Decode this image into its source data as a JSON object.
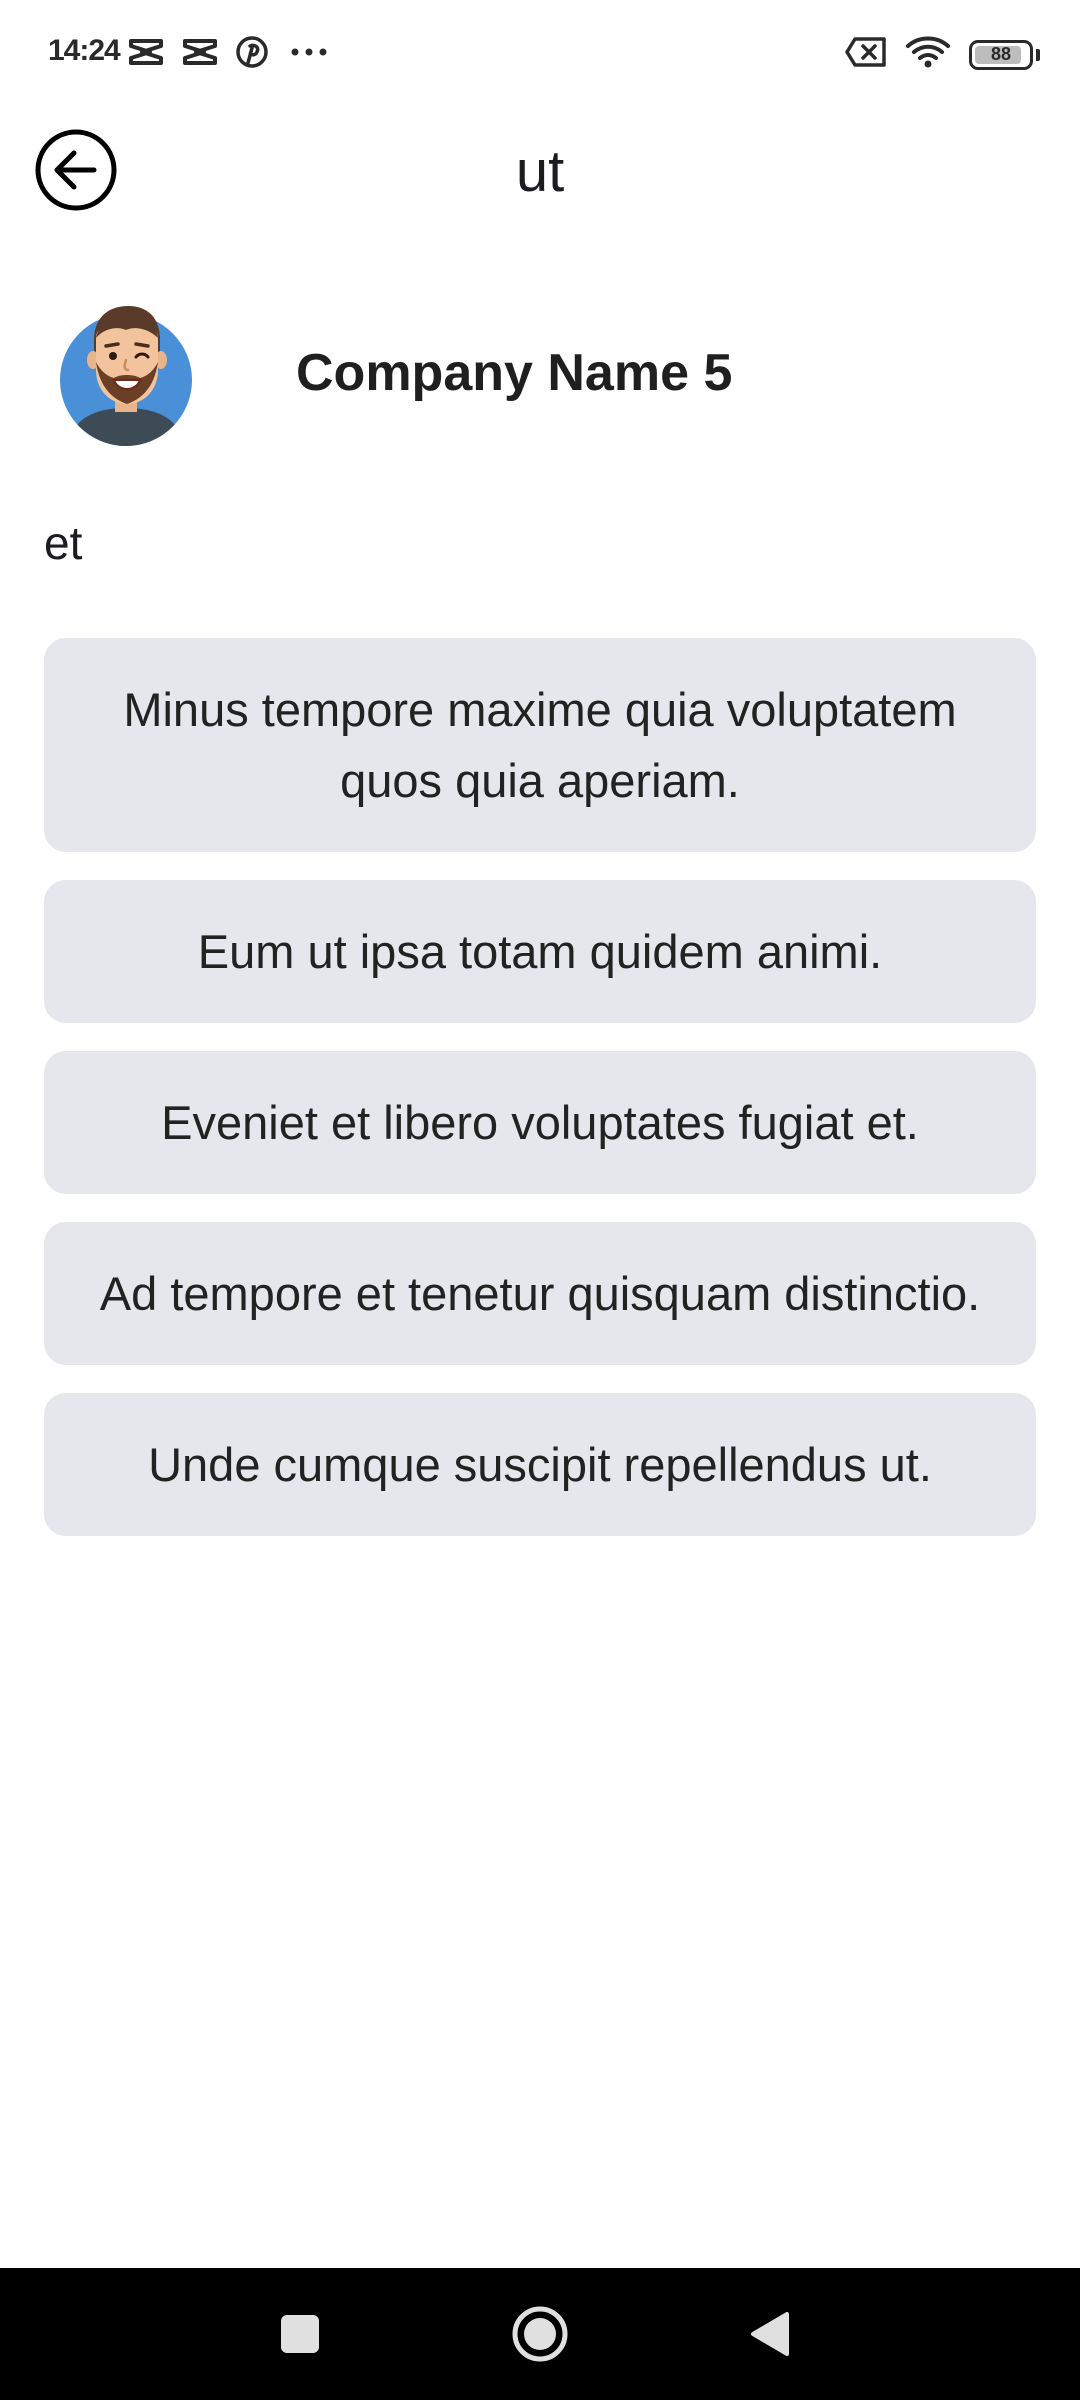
{
  "status_bar": {
    "time": "14:24",
    "battery_level": "88",
    "battery_fraction": 0.88,
    "icons_left": [
      "capcut-icon",
      "capcut-icon",
      "pinterest-icon",
      "more-dots-icon"
    ],
    "icons_right": [
      "no-sim-icon",
      "wifi-icon",
      "battery-icon"
    ]
  },
  "app_bar": {
    "title": "ut",
    "back_icon": "arrow-left-circle-icon"
  },
  "company": {
    "name": "Company Name 5",
    "avatar_icon": "bearded-man-avatar"
  },
  "subtitle": "et",
  "options": [
    {
      "label": "Minus tempore maxime quia voluptatem quos quia aperiam."
    },
    {
      "label": "Eum ut ipsa totam quidem animi."
    },
    {
      "label": "Eveniet et libero voluptates fugiat et."
    },
    {
      "label": "Ad tempore et tenetur quisquam distinctio."
    },
    {
      "label": "Unde cumque suscipit repellendus ut."
    }
  ],
  "colors": {
    "option_background": "#e5e7ed",
    "avatar_background": "#4a90d9",
    "nav_bar_background": "#000000"
  },
  "nav_bar": {
    "buttons": [
      "recents-square-icon",
      "home-circle-icon",
      "back-triangle-icon"
    ]
  }
}
